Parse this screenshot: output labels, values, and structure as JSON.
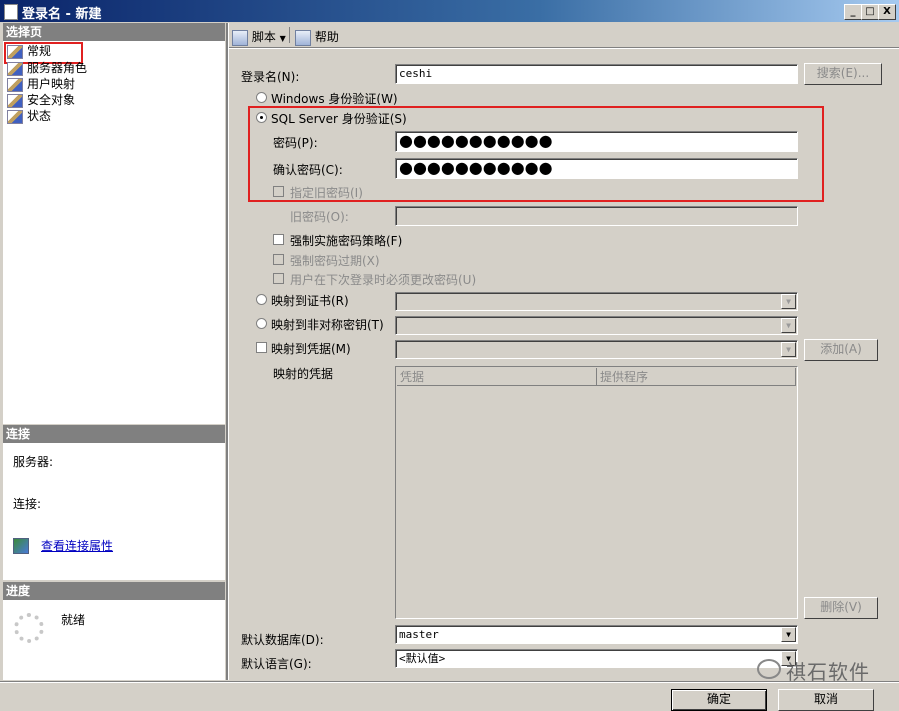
{
  "window": {
    "title": "登录名 - 新建",
    "buttons": [
      "_",
      "□",
      "X"
    ]
  },
  "left_pane": {
    "select_page_header": "选择页",
    "pages": [
      {
        "label": "常规",
        "icon": "page-icon"
      },
      {
        "label": "服务器角色",
        "icon": "page-icon"
      },
      {
        "label": "用户映射",
        "icon": "page-icon"
      },
      {
        "label": "安全对象",
        "icon": "page-icon"
      },
      {
        "label": "状态",
        "icon": "page-icon"
      }
    ],
    "connection_header": "连接",
    "server_label": "服务器:",
    "connection_label": "连接:",
    "view_connection_link": "查看连接属性",
    "progress_header": "进度",
    "progress_status": "就绪"
  },
  "toolbar": {
    "script_label": "脚本",
    "help_label": "帮助"
  },
  "form": {
    "login_name_label": "登录名(N):",
    "login_name_value": "ceshi",
    "search_button": "搜索(E)...",
    "windows_auth_label": "Windows 身份验证(W)",
    "sql_auth_label": "SQL Server 身份验证(S)",
    "password_label": "密码(P):",
    "password_value": "●●●●●●●●●●●",
    "confirm_password_label": "确认密码(C):",
    "confirm_password_value": "●●●●●●●●●●●",
    "specify_old_password_label": "指定旧密码(I)",
    "old_password_label": "旧密码(O):",
    "enforce_policy_label": "强制实施密码策略(F)",
    "enforce_expiration_label": "强制密码过期(X)",
    "must_change_label": "用户在下次登录时必须更改密码(U)",
    "map_cert_label": "映射到证书(R)",
    "map_asym_key_label": "映射到非对称密钥(T)",
    "map_credential_label": "映射到凭据(M)",
    "add_button": "添加(A)",
    "mapped_credentials_label": "映射的凭据",
    "grid_columns": [
      "凭据",
      "提供程序"
    ],
    "remove_button": "删除(V)",
    "default_db_label": "默认数据库(D):",
    "default_db_value": "master",
    "default_lang_label": "默认语言(G):",
    "default_lang_value": "<默认值>"
  },
  "footer": {
    "ok_button": "确定",
    "cancel_button": "取消"
  },
  "watermark": {
    "text": "祺石软件"
  },
  "colors": {
    "highlight_red": "#e02020",
    "title_blue": "#0a246a"
  }
}
